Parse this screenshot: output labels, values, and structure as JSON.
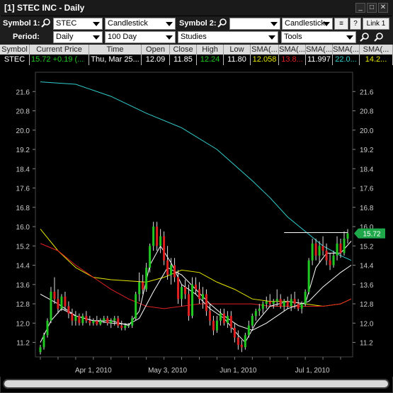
{
  "window": {
    "title": "[1] STEC INC - Daily"
  },
  "title_buttons": {
    "minimize": "_",
    "maximize": "□",
    "close": "✕"
  },
  "toolbar1": {
    "symbol1_label": "Symbol 1:",
    "symbol1_value": "STEC",
    "chart_type1": "Candlestick",
    "symbol2_label": "Symbol 2:",
    "symbol2_value": "",
    "chart_type2": "Candlestick",
    "help_label": "?",
    "link_label": "Link 1"
  },
  "toolbar2": {
    "period_label": "Period:",
    "period_value": "Daily",
    "range_value": "100 Day",
    "studies_value": "Studies",
    "tools_value": "Tools"
  },
  "grid": {
    "headers": [
      "Symbol",
      "Current Price",
      "Time",
      "Open",
      "Close",
      "High",
      "Low",
      "SMA(...",
      "SMA(...",
      "SMA(...",
      "SMA(...",
      "SMA(..."
    ],
    "row": {
      "symbol": "STEC",
      "price": "15.72",
      "change": "+0.19 (...",
      "time": "Thu, Mar 25...",
      "open": "12.09",
      "close": "11.85",
      "high": "12.24",
      "low": "11.80",
      "sma1": "12.058",
      "sma2": "13.8...",
      "sma3": "11.997",
      "sma4": "22.0...",
      "sma5": "14.2..."
    },
    "colors": {
      "green": "#21c821",
      "yellow": "#e6e600",
      "red": "#e02020",
      "white": "#ffffff",
      "cyan": "#33cccc"
    }
  },
  "chart_data": {
    "type": "candlestick",
    "symbol": "STEC",
    "ylim": [
      10.6,
      22.4
    ],
    "y_ticks": [
      11.2,
      12.0,
      12.8,
      13.6,
      14.4,
      15.2,
      16.0,
      16.8,
      17.6,
      18.4,
      19.2,
      20.0,
      20.8,
      21.6
    ],
    "x_tick_labels": [
      "Apr 1, 2010",
      "May 3, 2010",
      "Jun 1, 2010",
      "Jul 1, 2010"
    ],
    "x_tick_index": [
      15,
      36,
      56,
      77
    ],
    "last_price_label": "15.72",
    "reference_level": 15.75,
    "candles": [
      {
        "o": 10.8,
        "h": 11.1,
        "l": 10.7,
        "c": 11.0
      },
      {
        "o": 11.0,
        "h": 11.6,
        "l": 10.9,
        "c": 11.5
      },
      {
        "o": 11.5,
        "h": 12.2,
        "l": 11.4,
        "c": 12.1
      },
      {
        "o": 12.1,
        "h": 13.5,
        "l": 12.0,
        "c": 13.3
      },
      {
        "o": 13.3,
        "h": 13.9,
        "l": 12.8,
        "c": 13.0
      },
      {
        "o": 13.0,
        "h": 13.4,
        "l": 12.4,
        "c": 12.6
      },
      {
        "o": 12.6,
        "h": 13.2,
        "l": 12.5,
        "c": 13.1
      },
      {
        "o": 13.1,
        "h": 13.3,
        "l": 12.5,
        "c": 12.7
      },
      {
        "o": 12.7,
        "h": 12.9,
        "l": 12.2,
        "c": 12.4
      },
      {
        "o": 12.4,
        "h": 12.6,
        "l": 11.9,
        "c": 12.1
      },
      {
        "o": 12.1,
        "h": 12.5,
        "l": 11.9,
        "c": 12.3
      },
      {
        "o": 12.3,
        "h": 12.4,
        "l": 11.9,
        "c": 12.0
      },
      {
        "o": 12.0,
        "h": 12.4,
        "l": 11.9,
        "c": 12.3
      },
      {
        "o": 12.3,
        "h": 12.5,
        "l": 12.0,
        "c": 12.1
      },
      {
        "o": 12.1,
        "h": 12.3,
        "l": 11.9,
        "c": 12.0
      },
      {
        "o": 12.0,
        "h": 12.2,
        "l": 11.9,
        "c": 12.1
      },
      {
        "o": 12.1,
        "h": 12.3,
        "l": 11.9,
        "c": 11.95
      },
      {
        "o": 11.95,
        "h": 12.2,
        "l": 11.9,
        "c": 12.1
      },
      {
        "o": 12.1,
        "h": 12.3,
        "l": 12.0,
        "c": 12.2
      },
      {
        "o": 12.2,
        "h": 12.3,
        "l": 11.9,
        "c": 12.0
      },
      {
        "o": 12.0,
        "h": 12.2,
        "l": 11.8,
        "c": 12.1
      },
      {
        "o": 12.1,
        "h": 12.3,
        "l": 11.9,
        "c": 12.2
      },
      {
        "o": 12.2,
        "h": 12.3,
        "l": 11.8,
        "c": 11.9
      },
      {
        "o": 11.9,
        "h": 12.1,
        "l": 11.7,
        "c": 11.8
      },
      {
        "o": 11.8,
        "h": 12.0,
        "l": 11.7,
        "c": 11.9
      },
      {
        "o": 11.9,
        "h": 12.0,
        "l": 11.8,
        "c": 11.9
      },
      {
        "o": 11.9,
        "h": 12.3,
        "l": 11.8,
        "c": 12.2
      },
      {
        "o": 12.2,
        "h": 13.3,
        "l": 12.1,
        "c": 13.2
      },
      {
        "o": 13.2,
        "h": 14.1,
        "l": 12.9,
        "c": 13.7
      },
      {
        "o": 13.7,
        "h": 14.0,
        "l": 13.2,
        "c": 13.4
      },
      {
        "o": 13.4,
        "h": 14.5,
        "l": 13.3,
        "c": 14.3
      },
      {
        "o": 14.3,
        "h": 15.3,
        "l": 14.1,
        "c": 15.2
      },
      {
        "o": 15.2,
        "h": 16.2,
        "l": 15.0,
        "c": 16.0
      },
      {
        "o": 16.0,
        "h": 16.2,
        "l": 15.0,
        "c": 15.2
      },
      {
        "o": 15.2,
        "h": 15.9,
        "l": 14.9,
        "c": 15.6
      },
      {
        "o": 15.6,
        "h": 15.8,
        "l": 14.4,
        "c": 14.6
      },
      {
        "o": 14.6,
        "h": 15.2,
        "l": 13.8,
        "c": 14.0
      },
      {
        "o": 14.0,
        "h": 14.7,
        "l": 13.6,
        "c": 14.4
      },
      {
        "o": 14.4,
        "h": 14.7,
        "l": 13.7,
        "c": 13.9
      },
      {
        "o": 13.9,
        "h": 14.2,
        "l": 12.8,
        "c": 13.0
      },
      {
        "o": 13.0,
        "h": 13.6,
        "l": 12.7,
        "c": 13.5
      },
      {
        "o": 13.5,
        "h": 13.8,
        "l": 13.0,
        "c": 13.2
      },
      {
        "o": 13.2,
        "h": 13.6,
        "l": 12.1,
        "c": 12.3
      },
      {
        "o": 12.3,
        "h": 13.9,
        "l": 12.2,
        "c": 13.6
      },
      {
        "o": 13.6,
        "h": 13.9,
        "l": 13.2,
        "c": 13.4
      },
      {
        "o": 13.4,
        "h": 13.7,
        "l": 12.8,
        "c": 13.0
      },
      {
        "o": 13.0,
        "h": 13.5,
        "l": 12.6,
        "c": 13.2
      },
      {
        "o": 13.2,
        "h": 13.4,
        "l": 12.3,
        "c": 12.5
      },
      {
        "o": 12.5,
        "h": 12.8,
        "l": 11.9,
        "c": 12.1
      },
      {
        "o": 12.1,
        "h": 12.3,
        "l": 11.5,
        "c": 11.7
      },
      {
        "o": 11.7,
        "h": 12.3,
        "l": 11.6,
        "c": 12.1
      },
      {
        "o": 12.1,
        "h": 12.6,
        "l": 11.9,
        "c": 12.4
      },
      {
        "o": 12.4,
        "h": 12.6,
        "l": 11.9,
        "c": 12.0
      },
      {
        "o": 12.0,
        "h": 12.5,
        "l": 11.8,
        "c": 12.3
      },
      {
        "o": 12.3,
        "h": 12.5,
        "l": 11.6,
        "c": 11.8
      },
      {
        "o": 11.8,
        "h": 12.0,
        "l": 11.2,
        "c": 11.4
      },
      {
        "o": 11.4,
        "h": 11.7,
        "l": 10.9,
        "c": 11.1
      },
      {
        "o": 11.1,
        "h": 11.3,
        "l": 10.8,
        "c": 11.0
      },
      {
        "o": 11.0,
        "h": 11.6,
        "l": 10.9,
        "c": 11.5
      },
      {
        "o": 11.5,
        "h": 12.1,
        "l": 11.4,
        "c": 11.9
      },
      {
        "o": 11.9,
        "h": 12.4,
        "l": 11.8,
        "c": 12.3
      },
      {
        "o": 12.3,
        "h": 12.6,
        "l": 12.1,
        "c": 12.5
      },
      {
        "o": 12.5,
        "h": 12.8,
        "l": 12.3,
        "c": 12.6
      },
      {
        "o": 12.6,
        "h": 12.9,
        "l": 12.4,
        "c": 12.8
      },
      {
        "o": 12.8,
        "h": 13.1,
        "l": 12.6,
        "c": 12.9
      },
      {
        "o": 12.9,
        "h": 13.2,
        "l": 12.7,
        "c": 12.8
      },
      {
        "o": 12.8,
        "h": 13.0,
        "l": 12.6,
        "c": 12.9
      },
      {
        "o": 12.9,
        "h": 13.4,
        "l": 12.7,
        "c": 13.0
      },
      {
        "o": 13.0,
        "h": 13.2,
        "l": 12.6,
        "c": 12.7
      },
      {
        "o": 12.7,
        "h": 13.0,
        "l": 12.5,
        "c": 12.9
      },
      {
        "o": 12.9,
        "h": 13.1,
        "l": 12.6,
        "c": 12.7
      },
      {
        "o": 12.7,
        "h": 13.2,
        "l": 12.5,
        "c": 13.0
      },
      {
        "o": 13.0,
        "h": 13.3,
        "l": 12.6,
        "c": 12.8
      },
      {
        "o": 12.8,
        "h": 13.0,
        "l": 12.5,
        "c": 12.6
      },
      {
        "o": 12.6,
        "h": 12.9,
        "l": 12.4,
        "c": 12.8
      },
      {
        "o": 12.8,
        "h": 13.4,
        "l": 12.7,
        "c": 13.3
      },
      {
        "o": 13.3,
        "h": 14.7,
        "l": 13.2,
        "c": 14.6
      },
      {
        "o": 14.6,
        "h": 15.5,
        "l": 14.4,
        "c": 15.3
      },
      {
        "o": 15.3,
        "h": 15.5,
        "l": 14.6,
        "c": 14.8
      },
      {
        "o": 14.8,
        "h": 15.4,
        "l": 14.5,
        "c": 15.2
      },
      {
        "o": 15.2,
        "h": 15.6,
        "l": 14.8,
        "c": 15.0
      },
      {
        "o": 15.0,
        "h": 15.3,
        "l": 14.4,
        "c": 14.6
      },
      {
        "o": 14.6,
        "h": 14.9,
        "l": 14.2,
        "c": 14.4
      },
      {
        "o": 14.4,
        "h": 15.0,
        "l": 14.3,
        "c": 14.8
      },
      {
        "o": 14.8,
        "h": 15.6,
        "l": 14.6,
        "c": 15.3
      },
      {
        "o": 15.3,
        "h": 15.5,
        "l": 14.7,
        "c": 14.9
      },
      {
        "o": 14.9,
        "h": 15.8,
        "l": 14.8,
        "c": 15.5
      },
      {
        "o": 15.5,
        "h": 15.9,
        "l": 15.3,
        "c": 15.72
      }
    ],
    "indicators": [
      {
        "color": "#33cccc",
        "points": [
          [
            0,
            22.0
          ],
          [
            10,
            21.9
          ],
          [
            20,
            21.4
          ],
          [
            30,
            20.7
          ],
          [
            40,
            20.1
          ],
          [
            50,
            19.2
          ],
          [
            60,
            17.9
          ],
          [
            65,
            17.2
          ],
          [
            70,
            16.4
          ],
          [
            75,
            15.8
          ],
          [
            80,
            15.2
          ],
          [
            85,
            14.8
          ],
          [
            88,
            14.6
          ]
        ]
      },
      {
        "color": "#e6e600",
        "points": [
          [
            0,
            15.9
          ],
          [
            5,
            15.0
          ],
          [
            10,
            14.3
          ],
          [
            15,
            13.9
          ],
          [
            20,
            13.8
          ],
          [
            30,
            13.7
          ],
          [
            35,
            13.9
          ],
          [
            40,
            14.2
          ],
          [
            45,
            14.1
          ],
          [
            50,
            13.7
          ],
          [
            55,
            13.4
          ],
          [
            60,
            13.0
          ],
          [
            65,
            12.9
          ],
          [
            70,
            12.9
          ],
          [
            75,
            12.8
          ],
          [
            80,
            12.7
          ],
          [
            85,
            12.8
          ],
          [
            88,
            13.0
          ]
        ]
      },
      {
        "color": "#e02020",
        "points": [
          [
            0,
            15.3
          ],
          [
            5,
            15.0
          ],
          [
            10,
            14.4
          ],
          [
            15,
            13.9
          ],
          [
            20,
            13.4
          ],
          [
            25,
            13.0
          ],
          [
            30,
            12.7
          ],
          [
            35,
            12.6
          ],
          [
            40,
            12.7
          ],
          [
            45,
            12.8
          ],
          [
            50,
            12.8
          ],
          [
            55,
            12.8
          ],
          [
            60,
            12.8
          ],
          [
            65,
            12.7
          ],
          [
            70,
            12.7
          ],
          [
            75,
            12.7
          ],
          [
            80,
            12.7
          ],
          [
            85,
            12.8
          ],
          [
            88,
            13.0
          ]
        ]
      },
      {
        "color": "#ffffff",
        "points": [
          [
            0,
            13.2
          ],
          [
            5,
            12.8
          ],
          [
            10,
            12.3
          ],
          [
            15,
            12.1
          ],
          [
            20,
            12.0
          ],
          [
            25,
            11.95
          ],
          [
            28,
            12.2
          ],
          [
            32,
            13.3
          ],
          [
            36,
            14.3
          ],
          [
            40,
            14.0
          ],
          [
            44,
            13.4
          ],
          [
            48,
            12.8
          ],
          [
            52,
            12.3
          ],
          [
            56,
            11.9
          ],
          [
            60,
            11.7
          ],
          [
            64,
            12.0
          ],
          [
            70,
            12.6
          ],
          [
            76,
            12.9
          ],
          [
            80,
            13.5
          ],
          [
            85,
            14.1
          ],
          [
            88,
            14.4
          ]
        ]
      },
      {
        "color": "#ffffff",
        "points": [
          [
            0,
            11.2
          ],
          [
            3,
            12.1
          ],
          [
            6,
            12.6
          ],
          [
            10,
            12.3
          ],
          [
            15,
            12.1
          ],
          [
            20,
            12.1
          ],
          [
            25,
            11.9
          ],
          [
            28,
            12.5
          ],
          [
            31,
            14.4
          ],
          [
            34,
            15.2
          ],
          [
            37,
            14.5
          ],
          [
            40,
            13.6
          ],
          [
            44,
            13.2
          ],
          [
            48,
            12.6
          ],
          [
            52,
            12.2
          ],
          [
            56,
            11.5
          ],
          [
            58,
            11.2
          ],
          [
            61,
            12.0
          ],
          [
            65,
            12.7
          ],
          [
            70,
            12.9
          ],
          [
            75,
            12.8
          ],
          [
            78,
            14.3
          ],
          [
            81,
            14.9
          ],
          [
            85,
            14.9
          ],
          [
            88,
            15.4
          ]
        ]
      }
    ]
  }
}
